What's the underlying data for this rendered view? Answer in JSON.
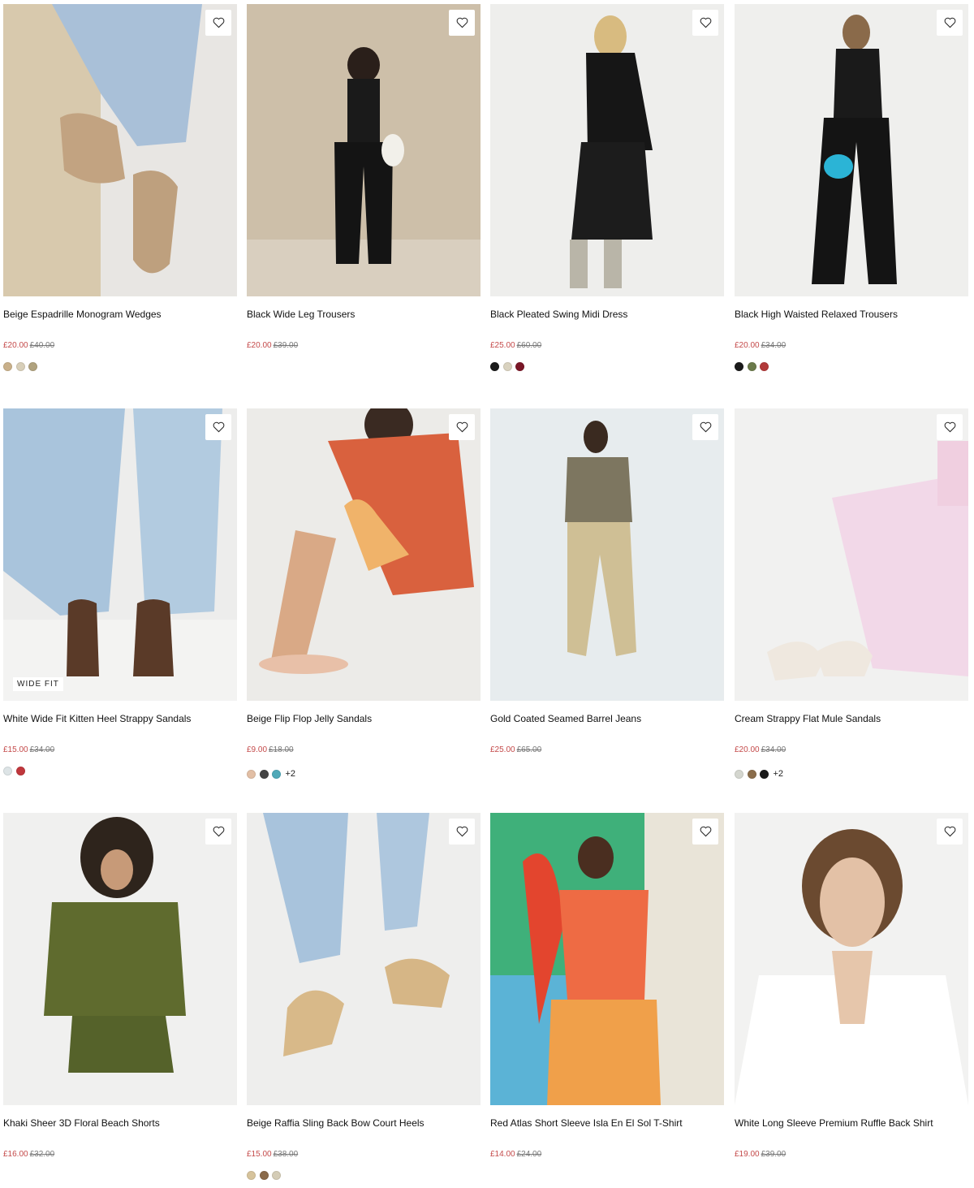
{
  "products": [
    {
      "title": "Beige Espadrille Monogram Wedges",
      "sale_price": "£20.00",
      "was_price": "£40.00",
      "swatches": [
        "#c9b08a",
        "#d8cfb9",
        "#b0a27e"
      ],
      "more": ""
    },
    {
      "title": "Black Wide Leg Trousers",
      "sale_price": "£20.00",
      "was_price": "£39.00",
      "swatches": [],
      "more": ""
    },
    {
      "title": "Black Pleated Swing Midi Dress",
      "sale_price": "£25.00",
      "was_price": "£60.00",
      "swatches": [
        "#1a1a1a",
        "#d9d2bf",
        "#7a1626"
      ],
      "more": ""
    },
    {
      "title": "Black High Waisted Relaxed Trousers",
      "sale_price": "£20.00",
      "was_price": "£34.00",
      "swatches": [
        "#1a1a1a",
        "#6b7a4a",
        "#b23a3a"
      ],
      "more": ""
    },
    {
      "title": "White Wide Fit Kitten Heel Strappy Sandals",
      "badge": "WIDE FIT",
      "sale_price": "£15.00",
      "was_price": "£34.00",
      "swatches": [
        "#dde4e6",
        "#c0373c"
      ],
      "more": ""
    },
    {
      "title": "Beige Flip Flop Jelly Sandals",
      "sale_price": "£9.00",
      "was_price": "£18.00",
      "swatches": [
        "#e2bfa5",
        "#444444",
        "#4fa9b8"
      ],
      "more": "+2"
    },
    {
      "title": "Gold Coated Seamed Barrel Jeans",
      "sale_price": "£25.00",
      "was_price": "£65.00",
      "swatches": [],
      "more": ""
    },
    {
      "title": "Cream Strappy Flat Mule Sandals",
      "sale_price": "£20.00",
      "was_price": "£34.00",
      "swatches": [
        "#d4d6cf",
        "#8a6d4b",
        "#1a1a1a"
      ],
      "more": "+2"
    },
    {
      "title": "Khaki Sheer 3D Floral Beach Shorts",
      "sale_price": "£16.00",
      "was_price": "£32.00",
      "swatches": [],
      "more": ""
    },
    {
      "title": "Beige Raffia Sling Back Bow Court Heels",
      "sale_price": "£15.00",
      "was_price": "£38.00",
      "swatches": [
        "#d6c39c",
        "#8a6a4a",
        "#d4ccb6"
      ],
      "more": ""
    },
    {
      "title": "Red Atlas Short Sleeve Isla En El Sol T-Shirt",
      "sale_price": "£14.00",
      "was_price": "£24.00",
      "swatches": [],
      "more": ""
    },
    {
      "title": "White Long Sleeve Premium Ruffle Back Shirt",
      "sale_price": "£19.00",
      "was_price": "£39.00",
      "swatches": [],
      "more": ""
    }
  ],
  "colors": {
    "sale": "#c44a4a",
    "was": "#777777"
  }
}
